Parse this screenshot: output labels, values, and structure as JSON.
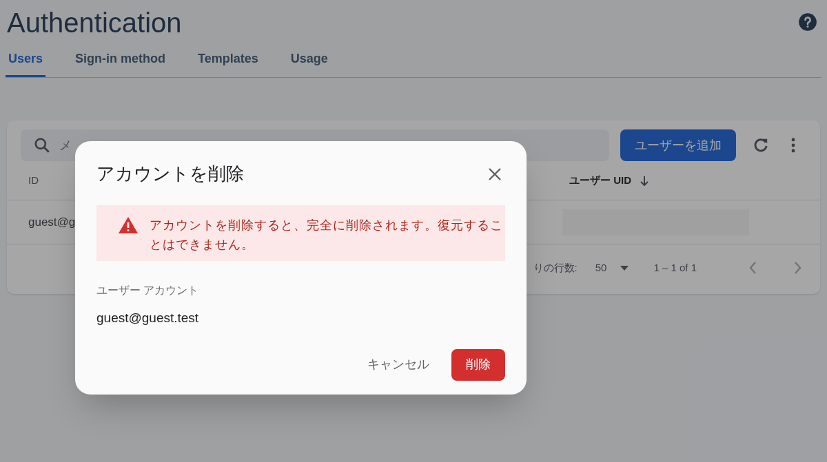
{
  "page": {
    "title": "Authentication"
  },
  "tabs": [
    {
      "label": "Users",
      "selected": true
    },
    {
      "label": "Sign-in method",
      "selected": false
    },
    {
      "label": "Templates",
      "selected": false
    },
    {
      "label": "Usage",
      "selected": false
    }
  ],
  "users_card": {
    "search": {
      "placeholder": "メ"
    },
    "add_button": "ユーザーを追加",
    "columns": [
      {
        "label": "ID",
        "sorted": false
      },
      {
        "label": "ユーザー UID",
        "sorted": true
      }
    ],
    "rows": [
      {
        "id": "guest@g",
        "uid_redacted": true
      }
    ],
    "pagination": {
      "rows_per_page_label": "りの行数:",
      "rows_per_page": "50",
      "range": "1 – 1 of 1"
    }
  },
  "dialog": {
    "title": "アカウントを削除",
    "warning": "アカウントを削除すると、完全に削除されます。復元することはできません。",
    "field_label": "ユーザー アカウント",
    "field_value": "guest@guest.test",
    "buttons": [
      {
        "kind": "text",
        "label": "キャンセル"
      },
      {
        "kind": "danger",
        "label": "削除"
      }
    ]
  }
}
